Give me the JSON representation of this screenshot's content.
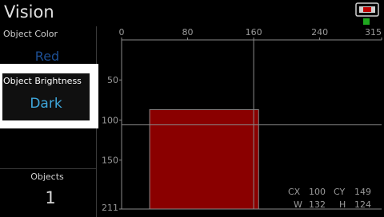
{
  "app": {
    "title": "Vision"
  },
  "icons": {
    "camera": "camera-icon",
    "status": "status-indicator"
  },
  "colors": {
    "accent_blue": "#3fa7dc",
    "red_label": "#1d4f94",
    "status_green": "#1fa81f",
    "blob_fill": "#8a0000"
  },
  "object_color": {
    "label": "Object Color",
    "value": "Red"
  },
  "object_brightness": {
    "label": "Object Brightness",
    "value": "Dark"
  },
  "objects": {
    "label": "Objects",
    "count": "1"
  },
  "chart_data": {
    "type": "scatter",
    "x_ticks": [
      "0",
      "80",
      "160",
      "240",
      "315"
    ],
    "y_ticks": [
      "50",
      "100",
      "150",
      "211"
    ],
    "xlim": [
      0,
      315
    ],
    "ylim": [
      0,
      211
    ],
    "y_inverted": true,
    "grid": false,
    "crosshair": {
      "x": 160,
      "y": 106
    },
    "blob": {
      "cx": 100,
      "cy": 149,
      "w": 132,
      "h": 124
    },
    "readout": {
      "cx_label": "CX",
      "cx": "100",
      "cy_label": "CY",
      "cy": "149",
      "w_label": "W",
      "w": "132",
      "h_label": "H",
      "h": "124"
    }
  }
}
